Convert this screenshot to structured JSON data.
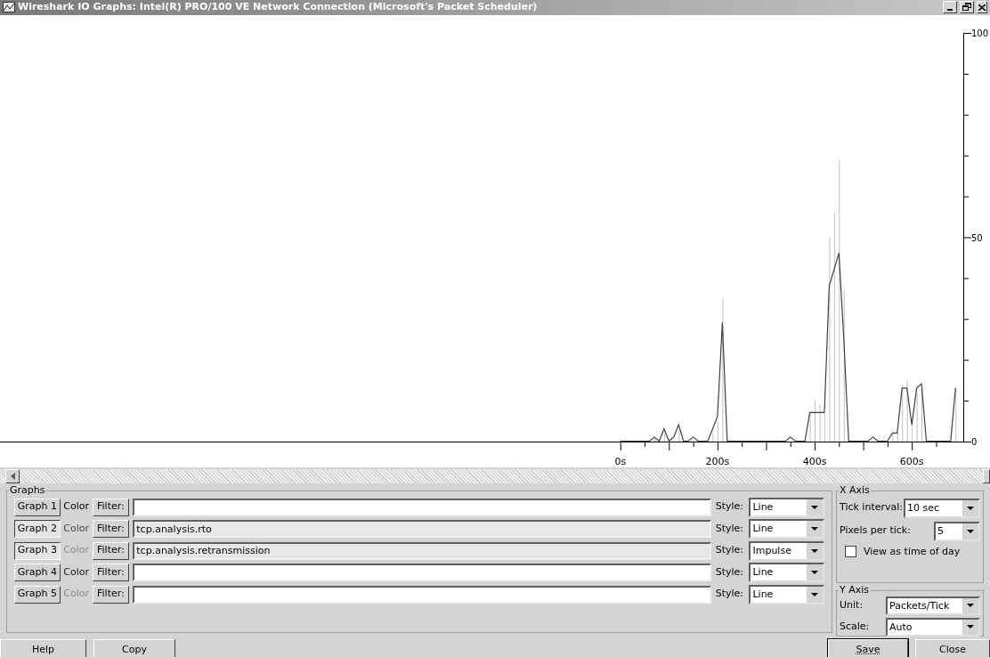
{
  "window": {
    "title": "Wireshark IO Graphs: Intel(R) PRO/100 VE Network Connection (Microsoft's Packet Scheduler)"
  },
  "chart": {
    "chart_data": {
      "type": "line",
      "x": [
        0,
        10,
        20,
        30,
        40,
        50,
        60,
        70,
        80,
        90,
        100,
        110,
        120,
        130,
        140,
        150,
        160,
        170,
        180,
        190,
        200,
        210,
        220,
        230,
        240,
        250,
        260,
        270,
        280,
        290,
        300,
        310,
        320,
        330,
        340,
        350,
        360,
        370,
        380,
        390,
        400,
        410,
        420,
        430,
        440,
        450,
        460,
        470,
        480,
        490,
        500,
        510,
        520,
        530,
        540,
        550,
        560,
        570,
        580,
        590,
        600,
        610,
        620,
        630,
        640,
        650,
        660,
        670,
        680,
        690
      ],
      "series": [
        {
          "color": "#404040",
          "values": [
            0,
            0,
            0,
            0,
            0,
            0,
            0,
            1,
            0,
            3,
            0,
            1,
            4,
            0,
            0,
            1,
            0,
            0,
            0,
            3,
            6,
            29,
            0,
            0,
            0,
            0,
            0,
            0,
            0,
            0,
            0,
            0,
            0,
            0,
            0,
            1,
            0,
            0,
            0,
            7,
            7,
            7,
            7,
            38,
            42,
            46,
            25,
            0,
            0,
            0,
            0,
            0,
            1,
            0,
            0,
            0,
            2,
            2,
            13,
            13,
            4,
            13,
            14,
            0,
            0,
            0,
            0,
            0,
            0,
            13
          ]
        }
      ],
      "xlim": [
        -1277,
        706
      ],
      "ylim": [
        0,
        100
      ],
      "xticks": [
        {
          "value": 0,
          "label": "0s"
        },
        {
          "value": 200,
          "label": "200s"
        },
        {
          "value": 400,
          "label": "400s"
        },
        {
          "value": 600,
          "label": "600s"
        }
      ],
      "yticks": [
        0,
        50,
        100
      ]
    }
  },
  "graphs": {
    "title": "Graphs",
    "rows": [
      {
        "label": "Graph 1",
        "selected": false,
        "color_label": "Color",
        "color": "#000000",
        "filter_button": "Filter:",
        "filter": "",
        "style_label": "Style:",
        "style": "Line"
      },
      {
        "label": "Graph 2",
        "selected": true,
        "color_label": "Color",
        "color": "#4a4a4a",
        "filter_button": "Filter:",
        "filter": "tcp.analysis.rto",
        "style_label": "Style:",
        "style": "Line"
      },
      {
        "label": "Graph 3",
        "selected": true,
        "color_label": "Color",
        "color": "#8e8e8e",
        "filter_button": "Filter:",
        "filter": "tcp.analysis.retransmission",
        "style_label": "Style:",
        "style": "Impulse"
      },
      {
        "label": "Graph 4",
        "selected": false,
        "color_label": "Color",
        "color": "#202020",
        "filter_button": "Filter:",
        "filter": "",
        "style_label": "Style:",
        "style": "Line"
      },
      {
        "label": "Graph 5",
        "selected": false,
        "color_label": "Color",
        "color": "#8a8a8a",
        "filter_button": "Filter:",
        "filter": "",
        "style_label": "Style:",
        "style": "Line"
      }
    ]
  },
  "x_axis": {
    "title": "X Axis",
    "tick_interval": {
      "label": "Tick interval:",
      "value": "10 sec"
    },
    "pixels_per_tick": {
      "label": "Pixels per tick:",
      "value": "5"
    },
    "view_as_time_of_day": {
      "label": "View as time of day",
      "checked": false
    }
  },
  "y_axis": {
    "title": "Y Axis",
    "unit": {
      "label": "Unit:",
      "value": "Packets/Tick"
    },
    "scale": {
      "label": "Scale:",
      "value": "Auto"
    }
  },
  "buttons": [
    {
      "label": "Help",
      "focused": false
    },
    {
      "label": "Copy",
      "focused": false
    },
    {
      "label": "Save",
      "focused": true
    },
    {
      "label": "Close",
      "focused": false
    }
  ]
}
